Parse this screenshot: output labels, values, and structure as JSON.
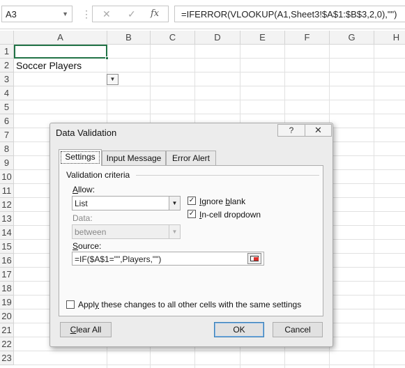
{
  "formula_bar": {
    "name_box": "A3",
    "cancel_icon": "✕",
    "enter_icon": "✓",
    "fx_label": "fx",
    "formula": "=IFERROR(VLOOKUP(A1,Sheet3!$A$1:$B$3,2,0),\"\")"
  },
  "columns": [
    "A",
    "B",
    "C",
    "D",
    "E",
    "F",
    "G",
    "H"
  ],
  "rows": [
    "1",
    "2",
    "3",
    "4",
    "5",
    "6",
    "7",
    "8",
    "9",
    "10",
    "11",
    "12",
    "13",
    "14",
    "15",
    "16",
    "17",
    "18",
    "19",
    "20",
    "21",
    "22",
    "23"
  ],
  "cells": {
    "a2": "Soccer Players"
  },
  "dialog": {
    "title": "Data Validation",
    "help_label": "?",
    "close_label": "✕",
    "tabs": [
      "Settings",
      "Input Message",
      "Error Alert"
    ],
    "criteria_label": "Validation criteria",
    "allow_label_u": "A",
    "allow_label_rest": "llow:",
    "allow_value": "List",
    "ignore_blank_u": "I",
    "ignore_blank_rest_pre": "gnore ",
    "ignore_blank_u2": "b",
    "ignore_blank_rest": "lank",
    "ignore_blank_checked": true,
    "in_cell_u": "I",
    "in_cell_rest": "n-cell dropdown",
    "in_cell_checked": true,
    "data_label": "Data:",
    "data_value": "between",
    "source_label_u": "S",
    "source_label_rest": "ource:",
    "source_value": "=IF($A$1=\"\",Players,\"\")",
    "apply_label_pre": "Appl",
    "apply_label_u": "y",
    "apply_label_rest": " these changes to all other cells with the same settings",
    "apply_checked": false,
    "clear_all_u": "C",
    "clear_all_rest": "lear All",
    "ok_label": "OK",
    "cancel_label": "Cancel"
  },
  "colors": {
    "selection": "#217346",
    "dialog_bg": "#ececec",
    "ok_border": "#3c7fb1"
  }
}
